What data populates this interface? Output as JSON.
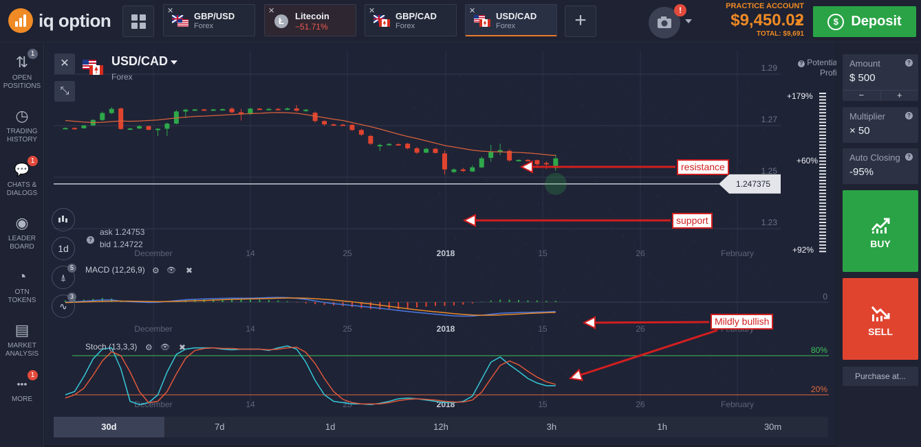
{
  "header": {
    "logo_text": "iq option",
    "tabs": [
      {
        "name": "GBP/USD",
        "sub": "Forex",
        "close": "✕"
      },
      {
        "name": "Litecoin",
        "sub": "−51.71%",
        "close": "✕"
      },
      {
        "name": "GBP/CAD",
        "sub": "Forex",
        "close": "✕"
      },
      {
        "name": "USD/CAD",
        "sub": "Forex",
        "close": "✕"
      }
    ],
    "add_tab": "+",
    "camera_alert": "!",
    "account_label": "PRACTICE ACCOUNT",
    "balance": "$9,450.02",
    "total": "TOTAL: $9,691",
    "deposit_label": "Deposit",
    "deposit_icon": "$"
  },
  "sidebar": {
    "items": [
      {
        "label1": "OPEN",
        "label2": "POSITIONS",
        "badge": "1",
        "icon": "⇅"
      },
      {
        "label1": "TRADING",
        "label2": "HISTORY",
        "badge": "",
        "icon": "◷"
      },
      {
        "label1": "CHATS &",
        "label2": "DIALOGS",
        "badge": "1",
        "icon": "💬"
      },
      {
        "label1": "LEADER",
        "label2": "BOARD",
        "badge": "",
        "icon": "◉"
      },
      {
        "label1": "OTN",
        "label2": "TOKENS",
        "badge": "",
        "icon": "◔"
      },
      {
        "label1": "MARKET",
        "label2": "ANALYSIS",
        "badge": "",
        "icon": "▤"
      },
      {
        "label1": "MORE",
        "label2": "",
        "badge": "1",
        "icon": "•••"
      }
    ]
  },
  "chart": {
    "asset": "USD/CAD",
    "asset_type": "Forex",
    "close_icon": "✕",
    "collapse_icon": "⤡",
    "ask": "ask 1.24753",
    "bid": "bid 1.24722",
    "info_icon": "?",
    "timeframe_btn": "1d",
    "draw_badge": "5",
    "ind_badge": "3",
    "potential_profit": "Potential Profit",
    "help_icon": "?",
    "pct_top": "+179%",
    "pct_mid": "+60%",
    "pct_bot": "+92%",
    "price_levels": [
      "1.29",
      "1.27",
      "1.25",
      "1.23"
    ],
    "current_price": "1.247375",
    "x_labels": [
      "December",
      "14",
      "25",
      "2018",
      "15",
      "26",
      "February"
    ],
    "macd_label": "MACD (12,26,9)",
    "macd_zero": "0",
    "stoch_label": "Stoch (13,3,3)",
    "stoch_80": "80%",
    "stoch_20": "20%",
    "gear_icon": "⚙",
    "eye_icon": "👁",
    "x_icon": "✖",
    "annotations": {
      "resistance": "resistance",
      "support": "support",
      "bullish": "Mildly bullish"
    }
  },
  "timebar": [
    "30d",
    "7d",
    "1d",
    "12h",
    "3h",
    "1h",
    "30m"
  ],
  "panel": {
    "amount_label": "Amount",
    "amount_value": "$  500",
    "minus": "−",
    "plus": "+",
    "multiplier_label": "Multiplier",
    "multiplier_value": "× 50",
    "auto_label": "Auto Closing",
    "auto_value": "-95%",
    "buy": "BUY",
    "sell": "SELL",
    "purchase": "Purchase at..."
  },
  "colors": {
    "up": "#2ea84a",
    "down": "#e0442f",
    "accent": "#ef8a25",
    "ma": "#d9623c"
  },
  "chart_data": {
    "type": "candlestick",
    "candles": [
      [
        1.269,
        1.2693,
        1.2688,
        1.2691
      ],
      [
        1.2691,
        1.2693,
        1.2689,
        1.269
      ],
      [
        1.269,
        1.2702,
        1.2688,
        1.2701
      ],
      [
        1.2701,
        1.2725,
        1.2699,
        1.2722
      ],
      [
        1.2722,
        1.2755,
        1.2718,
        1.2749
      ],
      [
        1.2749,
        1.2772,
        1.2745,
        1.2765
      ],
      [
        1.2767,
        1.277,
        1.2685,
        1.2687
      ],
      [
        1.2687,
        1.2692,
        1.2684,
        1.2689
      ],
      [
        1.2689,
        1.2701,
        1.2686,
        1.2698
      ],
      [
        1.2698,
        1.27,
        1.2682,
        1.2684
      ],
      [
        1.2684,
        1.269,
        1.266,
        1.2688
      ],
      [
        1.2688,
        1.2712,
        1.266,
        1.2708
      ],
      [
        1.2708,
        1.276,
        1.2705,
        1.2755
      ],
      [
        1.2755,
        1.2766,
        1.273,
        1.2762
      ],
      [
        1.2762,
        1.2765,
        1.2759,
        1.2763
      ],
      [
        1.2763,
        1.2765,
        1.2759,
        1.2761
      ],
      [
        1.2761,
        1.2765,
        1.2758,
        1.2763
      ],
      [
        1.2763,
        1.2767,
        1.2759,
        1.2764
      ],
      [
        1.2766,
        1.2772,
        1.2748,
        1.2752
      ],
      [
        1.2752,
        1.2765,
        1.272,
        1.2745
      ],
      [
        1.2745,
        1.277,
        1.2742,
        1.2766
      ],
      [
        1.2766,
        1.2769,
        1.2762,
        1.2765
      ],
      [
        1.2765,
        1.2768,
        1.2762,
        1.2765
      ],
      [
        1.2765,
        1.2769,
        1.2761,
        1.2764
      ],
      [
        1.2764,
        1.277,
        1.276,
        1.2767
      ],
      [
        1.2767,
        1.278,
        1.2755,
        1.2758
      ],
      [
        1.2761,
        1.2765,
        1.2753,
        1.2762
      ],
      [
        1.275,
        1.2755,
        1.2712,
        1.2718
      ],
      [
        1.2718,
        1.272,
        1.27,
        1.2705
      ],
      [
        1.2705,
        1.2708,
        1.2702,
        1.2704
      ],
      [
        1.2704,
        1.2707,
        1.27,
        1.2703
      ],
      [
        1.2703,
        1.2707,
        1.268,
        1.2683
      ],
      [
        1.2683,
        1.2687,
        1.266,
        1.2665
      ],
      [
        1.266,
        1.2665,
        1.2625,
        1.263
      ],
      [
        1.2624,
        1.263,
        1.2602,
        1.2625
      ],
      [
        1.2627,
        1.2632,
        1.2622,
        1.2629
      ],
      [
        1.2628,
        1.2632,
        1.2624,
        1.2627
      ],
      [
        1.263,
        1.2633,
        1.2608,
        1.2612
      ],
      [
        1.2612,
        1.2617,
        1.259,
        1.2595
      ],
      [
        1.2595,
        1.2614,
        1.2594,
        1.261
      ],
      [
        1.261,
        1.2614,
        1.2592,
        1.2594
      ],
      [
        1.2592,
        1.2603,
        1.251,
        1.253
      ],
      [
        1.252,
        1.2534,
        1.2516,
        1.253
      ],
      [
        1.253,
        1.2536,
        1.252,
        1.2524
      ],
      [
        1.2522,
        1.2546,
        1.252,
        1.2538
      ],
      [
        1.2538,
        1.258,
        1.2535,
        1.2573
      ],
      [
        1.2575,
        1.2625,
        1.256,
        1.2598
      ],
      [
        1.2598,
        1.263,
        1.2585,
        1.2605
      ],
      [
        1.2602,
        1.2608,
        1.256,
        1.2565
      ],
      [
        1.2565,
        1.2569,
        1.2563,
        1.2567
      ],
      [
        1.2567,
        1.257,
        1.2563,
        1.2566
      ],
      [
        1.2566,
        1.2568,
        1.2535,
        1.255
      ],
      [
        1.2555,
        1.2562,
        1.2532,
        1.2553
      ],
      [
        1.2535,
        1.2588,
        1.2525,
        1.2573
      ]
    ],
    "ma": [
      1.272,
      1.2717,
      1.2714,
      1.2712,
      1.2713,
      1.2716,
      1.2718,
      1.2717,
      1.2718,
      1.272,
      1.2722,
      1.2726,
      1.273,
      1.2733,
      1.2736,
      1.2737,
      1.2739,
      1.2741,
      1.2743,
      1.2745,
      1.2747,
      1.2748,
      1.275,
      1.2751,
      1.275,
      1.2748,
      1.2743,
      1.2737,
      1.2731,
      1.2725,
      1.272,
      1.2712,
      1.2704,
      1.2696,
      1.2687,
      1.2677,
      1.2667,
      1.2658,
      1.265,
      1.2641,
      1.2632,
      1.2623,
      1.2617,
      1.2611,
      1.2605,
      1.2601,
      1.2599,
      1.2598,
      1.2597,
      1.2596,
      1.2594,
      1.2591,
      1.2587,
      1.2584
    ],
    "macd_hist": [
      0.4,
      0.5,
      0.6,
      0.8,
      1.0,
      0.9,
      0.3,
      0.2,
      0.2,
      0.1,
      0.1,
      0.2,
      0.4,
      0.5,
      0.6,
      0.7,
      0.7,
      0.7,
      0.6,
      0.6,
      0.6,
      0.6,
      0.5,
      0.4,
      0.2,
      -0.1,
      -0.3,
      -0.5,
      -0.7,
      -0.8,
      -1.0,
      -1.2,
      -1.5,
      -1.7,
      -1.8,
      -1.8,
      -1.7,
      -1.5,
      -1.3,
      -1.1,
      -0.9,
      -0.9,
      -0.8,
      -0.6,
      -0.3,
      0.1,
      0.4,
      0.6,
      0.6,
      0.5,
      0.4,
      0.4,
      0.3,
      0.3
    ],
    "macd_line": [
      0.0,
      0.3,
      0.6,
      1.0,
      1.5,
      1.5,
      0.7,
      0.3,
      0.0,
      -0.2,
      -0.1,
      0.4,
      1.0,
      1.6,
      1.9,
      2.1,
      2.3,
      2.5,
      2.6,
      2.6,
      2.6,
      2.8,
      3.0,
      3.1,
      3.0,
      2.5,
      1.8,
      0.8,
      -0.2,
      -1.0,
      -1.6,
      -2.2,
      -2.8,
      -3.4,
      -4.1,
      -4.8,
      -5.5,
      -6.2,
      -6.8,
      -7.4,
      -8.0,
      -8.6,
      -9.1,
      -9.3,
      -9.2,
      -8.7,
      -8.0,
      -7.4,
      -7.1,
      -6.9,
      -6.8,
      -6.6,
      -6.5,
      -6.2
    ],
    "macd_signal": [
      -0.3,
      -0.1,
      0.1,
      0.3,
      0.5,
      0.7,
      0.7,
      0.6,
      0.5,
      0.4,
      0.3,
      0.4,
      0.5,
      0.7,
      0.9,
      1.1,
      1.3,
      1.6,
      1.8,
      2.0,
      2.1,
      2.3,
      2.4,
      2.6,
      2.7,
      2.7,
      2.6,
      2.3,
      1.9,
      1.4,
      0.8,
      0.2,
      -0.5,
      -1.2,
      -2.0,
      -2.8,
      -3.6,
      -4.4,
      -5.1,
      -5.8,
      -6.4,
      -7.0,
      -7.6,
      -8.1,
      -8.5,
      -8.7,
      -8.7,
      -8.5,
      -8.2,
      -7.9,
      -7.5,
      -7.3,
      -7.0,
      -6.8
    ],
    "stoch_k": [
      20,
      25,
      48,
      75,
      90,
      92,
      60,
      10,
      5,
      8,
      20,
      55,
      82,
      90,
      92,
      92,
      92,
      90,
      89,
      90,
      90,
      90,
      88,
      92,
      95,
      90,
      70,
      42,
      20,
      10,
      8,
      6,
      6,
      5,
      7,
      10,
      14,
      15,
      14,
      12,
      10,
      8,
      8,
      10,
      18,
      44,
      70,
      78,
      66,
      56,
      45,
      38,
      34,
      34
    ],
    "stoch_d": [
      15,
      20,
      30,
      50,
      72,
      86,
      80,
      55,
      25,
      8,
      10,
      25,
      52,
      76,
      88,
      91,
      92,
      91,
      91,
      90,
      90,
      90,
      89,
      90,
      92,
      93,
      85,
      68,
      45,
      25,
      13,
      8,
      6,
      6,
      6,
      8,
      11,
      13,
      14,
      13,
      12,
      10,
      9,
      9,
      12,
      24,
      45,
      65,
      72,
      66,
      56,
      47,
      40,
      36
    ],
    "ylim": [
      1.222,
      1.294
    ],
    "price_ticks": [
      1.29,
      1.27,
      1.25,
      1.23
    ],
    "current": 1.247375
  }
}
